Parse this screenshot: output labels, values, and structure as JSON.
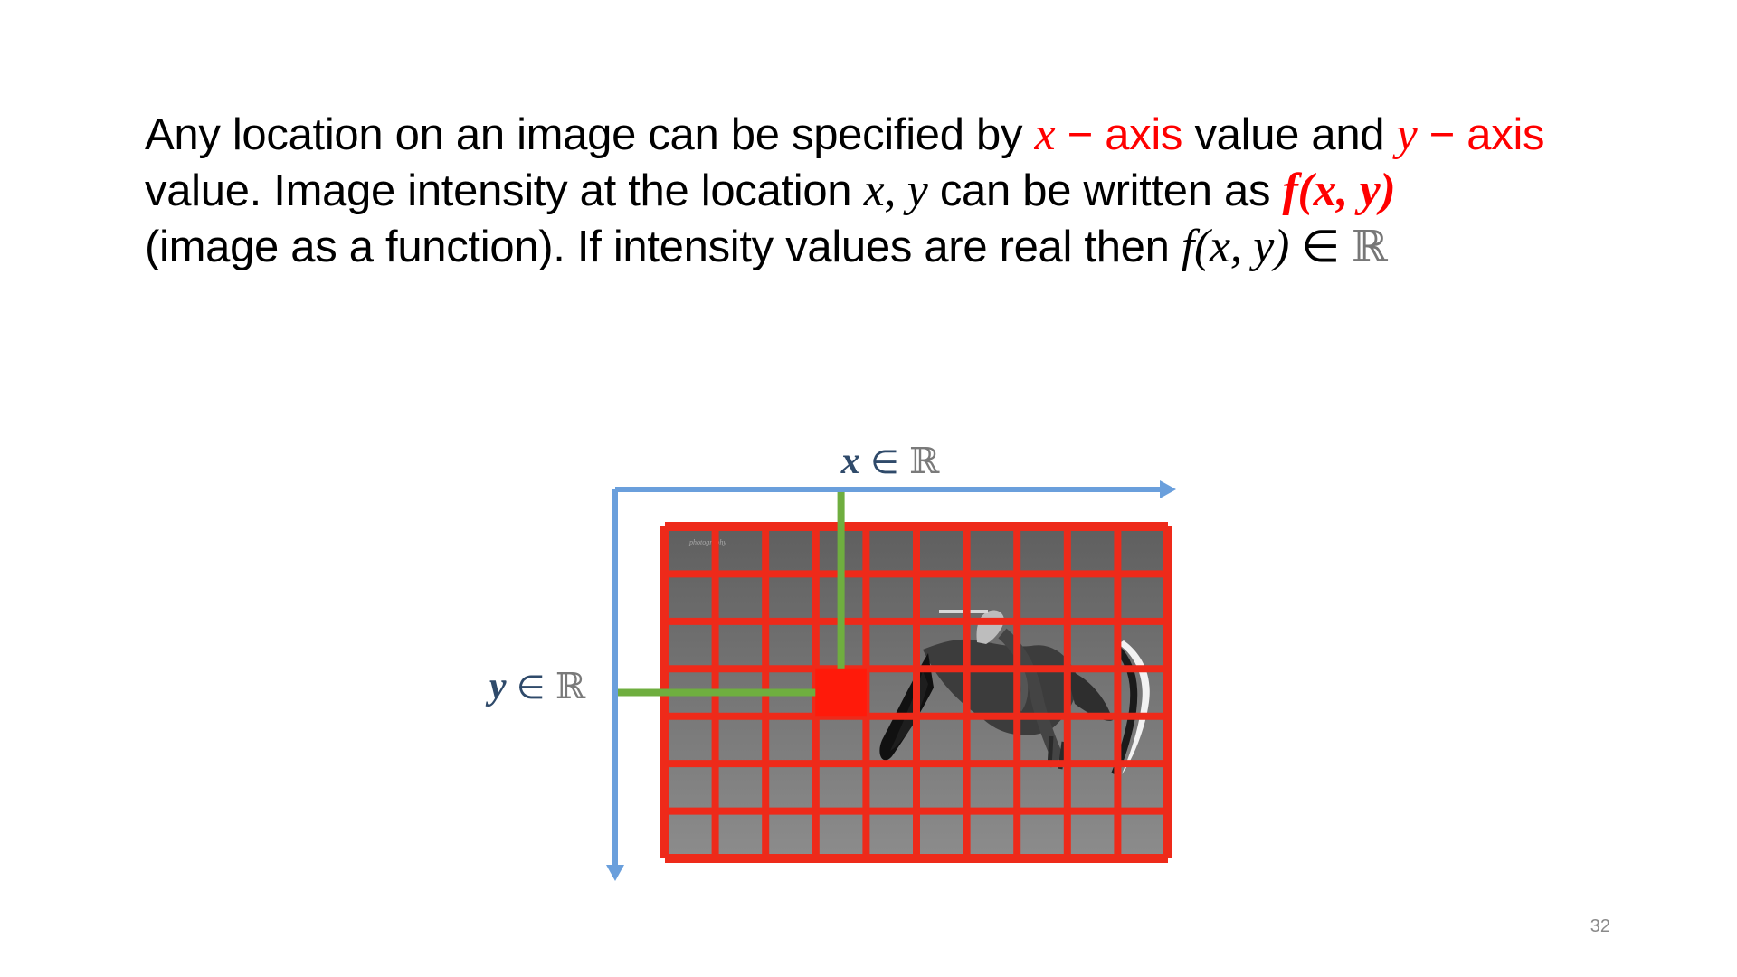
{
  "text": {
    "line1": {
      "part1": "Any location on an image can be specified by ",
      "x_var": "x",
      "axis_a": " − axis",
      "part2": " value and ",
      "y_var": "y",
      "axis_b": " − axis"
    },
    "line2": {
      "part1": "value. Image intensity at the location ",
      "xy": "x, y",
      "part2": " can be written as ",
      "fxy": "f(x, y)"
    },
    "line3": {
      "part1": "(image as a function). If intensity values are real then ",
      "fxy": "f(x, y)",
      "in": " ∈ ",
      "reals": "ℝ"
    }
  },
  "diagram": {
    "x_axis_label": {
      "var": "x",
      "in": " ∈ ",
      "set": "ℝ"
    },
    "y_axis_label": {
      "var": "y",
      "in": " ∈ ",
      "set": "ℝ"
    },
    "grid": {
      "columns": 10,
      "rows": 7,
      "highlight": {
        "column": 4,
        "row": 4
      }
    },
    "colors": {
      "axis": "#6a9fdc",
      "grid_lines": "#ee2a1a",
      "highlight_cell": "#ff1a0a",
      "pointer_lines": "#6fae3f",
      "label_text": "#2f4a6a",
      "image_background": "#7a7a7a"
    }
  },
  "page_number": "32"
}
